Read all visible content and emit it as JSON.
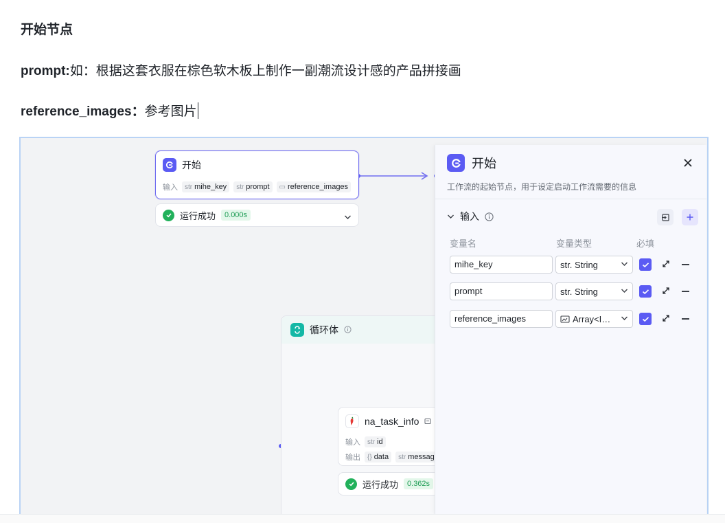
{
  "doc": {
    "heading": "开始节点",
    "prompt_key": "prompt:",
    "prompt_value": "如：根据这套衣服在棕色软木板上制作一副潮流设计感的产品拼接画",
    "ref_key": "reference_images：",
    "ref_value": "参考图片"
  },
  "start_node": {
    "title": "开始",
    "input_label": "输入",
    "inputs": [
      {
        "type": "str",
        "name": "mihe_key"
      },
      {
        "type": "str",
        "name": "prompt"
      },
      {
        "type": "img",
        "name": "reference_images"
      }
    ],
    "status": "运行成功",
    "time": "0.000s"
  },
  "loop_node": {
    "title": "循环体"
  },
  "task_node": {
    "title": "na_task_info",
    "input_label": "输入",
    "output_label": "输出",
    "inputs": [
      {
        "type": "str",
        "name": "id"
      }
    ],
    "outputs": [
      {
        "type": "{}",
        "name": "data"
      },
      {
        "type": "str",
        "name": "message"
      }
    ],
    "status": "运行成功",
    "time": "0.362s"
  },
  "panel": {
    "title": "开始",
    "description": "工作流的起始节点，用于设定启动工作流需要的信息",
    "section": "输入",
    "col_name": "变量名",
    "col_type": "变量类型",
    "col_required": "必填",
    "rows": [
      {
        "name": "mihe_key",
        "type": "str. String"
      },
      {
        "name": "prompt",
        "type": "str. String"
      },
      {
        "name": "reference_images",
        "type": "Array<I…"
      }
    ]
  },
  "colors": {
    "accent": "#5b5bf3",
    "success": "#22b15b",
    "edge": "#6f6cf0"
  }
}
